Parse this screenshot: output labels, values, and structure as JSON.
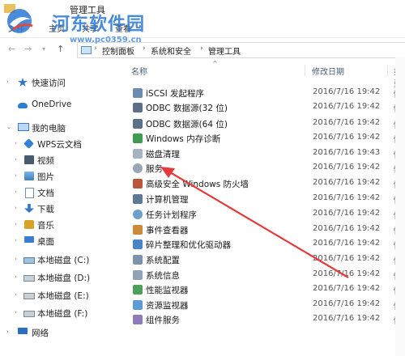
{
  "window": {
    "title": "管理工具"
  },
  "ribbon": {
    "tabs": [
      "文件",
      "主页",
      "共享",
      "查看"
    ]
  },
  "address": {
    "crumbs": [
      "控制面板",
      "系统和安全",
      "管理工具"
    ]
  },
  "columns": {
    "name": "名称",
    "modified": "修改日期",
    "type": "类型"
  },
  "sidebar": {
    "items": [
      {
        "label": "快速访问",
        "icon": "star-icon"
      },
      {
        "label": "OneDrive",
        "icon": "cloud-icon"
      },
      {
        "label": "我的电脑",
        "icon": "computer-icon"
      },
      {
        "label": "WPS云文档",
        "icon": "wps-icon"
      },
      {
        "label": "视频",
        "icon": "video-icon"
      },
      {
        "label": "图片",
        "icon": "picture-icon"
      },
      {
        "label": "文档",
        "icon": "document-icon"
      },
      {
        "label": "下载",
        "icon": "download-icon"
      },
      {
        "label": "音乐",
        "icon": "music-icon"
      },
      {
        "label": "桌面",
        "icon": "desktop-icon"
      },
      {
        "label": "本地磁盘 (C:)",
        "icon": "drive-icon"
      },
      {
        "label": "本地磁盘 (D:)",
        "icon": "drive-icon"
      },
      {
        "label": "本地磁盘 (E:)",
        "icon": "drive-icon"
      },
      {
        "label": "本地磁盘 (F:)",
        "icon": "drive-icon"
      },
      {
        "label": "网络",
        "icon": "network-icon"
      }
    ]
  },
  "files": [
    {
      "name": "iSCSI 发起程序",
      "date": "2016/7/16 19:42",
      "type": "快"
    },
    {
      "name": "ODBC 数据源(32 位)",
      "date": "2016/7/16 19:42",
      "type": "快"
    },
    {
      "name": "ODBC 数据源(64 位)",
      "date": "2016/7/16 19:42",
      "type": "快"
    },
    {
      "name": "Windows 内存诊断",
      "date": "2016/7/16 19:42",
      "type": "快"
    },
    {
      "name": "磁盘清理",
      "date": "2016/7/16 19:43",
      "type": "快"
    },
    {
      "name": "服务",
      "date": "2016/7/16 19:42",
      "type": "快"
    },
    {
      "name": "高级安全 Windows 防火墙",
      "date": "2016/7/16 19:42",
      "type": "快"
    },
    {
      "name": "计算机管理",
      "date": "2016/7/16 19:42",
      "type": "快"
    },
    {
      "name": "任务计划程序",
      "date": "2016/7/16 19:42",
      "type": "快"
    },
    {
      "name": "事件查看器",
      "date": "2016/7/16 19:42",
      "type": "快"
    },
    {
      "name": "碎片整理和优化驱动器",
      "date": "2016/7/16 19:42",
      "type": "快"
    },
    {
      "name": "系统配置",
      "date": "2016/7/16 19:42",
      "type": "快"
    },
    {
      "name": "系统信息",
      "date": "2016/7/16 19:42",
      "type": "快"
    },
    {
      "name": "性能监视器",
      "date": "2016/7/16 19:42",
      "type": "快"
    },
    {
      "name": "资源监视器",
      "date": "2016/7/16 19:42",
      "type": "快"
    },
    {
      "name": "组件服务",
      "date": "2016/7/16 19:42",
      "type": "快"
    }
  ],
  "watermark": {
    "text": "河东软件园",
    "url": "www.pc0359.cn"
  },
  "colors": {
    "accent": "#2a77d4",
    "arrow": "#e5393b"
  }
}
